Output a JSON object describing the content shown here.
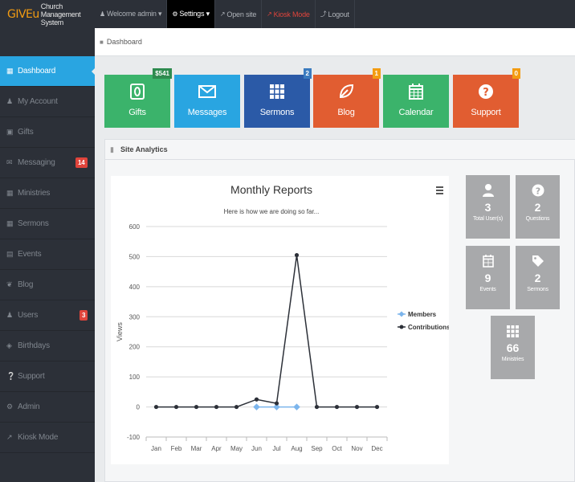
{
  "brand": {
    "logo": "GIVEu",
    "subtitle": "Church Management System"
  },
  "topnav": [
    {
      "label": "Welcome admin ▾",
      "icon": "user-icon"
    },
    {
      "label": "Settings ▾",
      "icon": "gear-icon"
    },
    {
      "label": "Open site",
      "icon": "external-link-icon"
    },
    {
      "label": "Kiosk Mode",
      "icon": "kiosk-icon"
    },
    {
      "label": "Logout",
      "icon": "logout-icon"
    }
  ],
  "breadcrumb": {
    "label": "Dashboard",
    "icon": "home-icon"
  },
  "sidebar": [
    {
      "label": "Dashboard",
      "icon": "dashboard-icon"
    },
    {
      "label": "My Account",
      "icon": "user-icon"
    },
    {
      "label": "Gifts",
      "icon": "gift-icon"
    },
    {
      "label": "Messaging",
      "icon": "envelope-icon",
      "badge": "14"
    },
    {
      "label": "Ministries",
      "icon": "grid-icon"
    },
    {
      "label": "Sermons",
      "icon": "grid-icon"
    },
    {
      "label": "Events",
      "icon": "calendar-icon"
    },
    {
      "label": "Blog",
      "icon": "leaf-icon"
    },
    {
      "label": "Users",
      "icon": "user-icon",
      "badge": "3"
    },
    {
      "label": "Birthdays",
      "icon": "cake-icon"
    },
    {
      "label": "Support",
      "icon": "question-icon"
    },
    {
      "label": "Admin",
      "icon": "gear-icon"
    },
    {
      "label": "Kiosk Mode",
      "icon": "external-link-icon"
    }
  ],
  "tiles": [
    {
      "label": "Gifts",
      "icon": "money-icon",
      "color": "#3bb36b",
      "badge": "$541",
      "badge_color": "#2e8b4f"
    },
    {
      "label": "Messages",
      "icon": "envelope-icon",
      "color": "#29a5e1"
    },
    {
      "label": "Sermons",
      "icon": "grid-icon",
      "color": "#2b5aa7",
      "badge": "2",
      "badge_color": "#3b7bbf"
    },
    {
      "label": "Blog",
      "icon": "leaf-icon",
      "color": "#e15d31",
      "badge": "1",
      "badge_color": "#f39c12"
    },
    {
      "label": "Calendar",
      "icon": "calendar-icon",
      "color": "#3bb36b"
    },
    {
      "label": "Support",
      "icon": "question-icon",
      "color": "#e15d31",
      "badge": "0",
      "badge_color": "#f39c12"
    }
  ],
  "panel": {
    "title": "Site Analytics",
    "icon": "bar-chart-icon"
  },
  "stats": [
    {
      "value": "3",
      "label": "Total User(s)",
      "icon": "user-icon"
    },
    {
      "value": "2",
      "label": "Questions",
      "icon": "question-icon"
    },
    {
      "value": "9",
      "label": "Events",
      "icon": "calendar-icon"
    },
    {
      "value": "2",
      "label": "Sermons",
      "icon": "tag-icon"
    },
    {
      "value": "66",
      "label": "Ministries",
      "icon": "grid-icon"
    }
  ],
  "colors": {
    "sidebar_bg": "#2c3038",
    "accent": "#29a5e1",
    "badge_red": "#e0443b",
    "stat_bg": "#a8a9ab"
  },
  "chart_data": {
    "type": "line",
    "title": "Monthly Reports",
    "subtitle": "Here is how we are doing so far...",
    "ylabel": "Views",
    "xlabel": "",
    "ylim": [
      -100,
      600
    ],
    "yticks": [
      -100,
      0,
      100,
      200,
      300,
      400,
      500,
      600
    ],
    "categories": [
      "Jan",
      "Feb",
      "Mar",
      "Apr",
      "May",
      "Jun",
      "Jul",
      "Aug",
      "Sep",
      "Oct",
      "Nov",
      "Dec"
    ],
    "series": [
      {
        "name": "Members",
        "color": "#7cb5ec",
        "values": [
          null,
          null,
          null,
          null,
          null,
          0,
          0,
          0,
          null,
          null,
          null,
          null
        ]
      },
      {
        "name": "Contributions",
        "color": "#2c3038",
        "values": [
          0,
          0,
          0,
          0,
          0,
          25,
          12,
          505,
          0,
          0,
          0,
          0
        ]
      }
    ],
    "legend_position": "right",
    "grid": true
  }
}
